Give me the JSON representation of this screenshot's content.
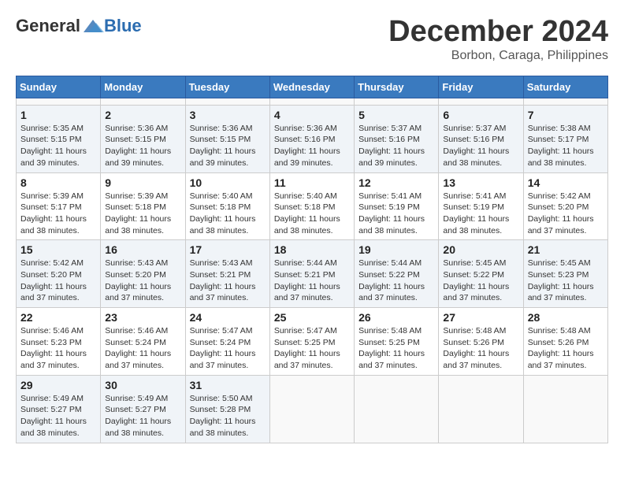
{
  "header": {
    "logo_general": "General",
    "logo_blue": "Blue",
    "month_title": "December 2024",
    "location": "Borbon, Caraga, Philippines"
  },
  "calendar": {
    "headers": [
      "Sunday",
      "Monday",
      "Tuesday",
      "Wednesday",
      "Thursday",
      "Friday",
      "Saturday"
    ],
    "weeks": [
      [
        null,
        null,
        null,
        null,
        null,
        null,
        null
      ],
      [
        {
          "day": "1",
          "sunrise": "5:35 AM",
          "sunset": "5:15 PM",
          "daylight": "11 hours and 39 minutes."
        },
        {
          "day": "2",
          "sunrise": "5:36 AM",
          "sunset": "5:15 PM",
          "daylight": "11 hours and 39 minutes."
        },
        {
          "day": "3",
          "sunrise": "5:36 AM",
          "sunset": "5:15 PM",
          "daylight": "11 hours and 39 minutes."
        },
        {
          "day": "4",
          "sunrise": "5:36 AM",
          "sunset": "5:16 PM",
          "daylight": "11 hours and 39 minutes."
        },
        {
          "day": "5",
          "sunrise": "5:37 AM",
          "sunset": "5:16 PM",
          "daylight": "11 hours and 39 minutes."
        },
        {
          "day": "6",
          "sunrise": "5:37 AM",
          "sunset": "5:16 PM",
          "daylight": "11 hours and 38 minutes."
        },
        {
          "day": "7",
          "sunrise": "5:38 AM",
          "sunset": "5:17 PM",
          "daylight": "11 hours and 38 minutes."
        }
      ],
      [
        {
          "day": "8",
          "sunrise": "5:39 AM",
          "sunset": "5:17 PM",
          "daylight": "11 hours and 38 minutes."
        },
        {
          "day": "9",
          "sunrise": "5:39 AM",
          "sunset": "5:18 PM",
          "daylight": "11 hours and 38 minutes."
        },
        {
          "day": "10",
          "sunrise": "5:40 AM",
          "sunset": "5:18 PM",
          "daylight": "11 hours and 38 minutes."
        },
        {
          "day": "11",
          "sunrise": "5:40 AM",
          "sunset": "5:18 PM",
          "daylight": "11 hours and 38 minutes."
        },
        {
          "day": "12",
          "sunrise": "5:41 AM",
          "sunset": "5:19 PM",
          "daylight": "11 hours and 38 minutes."
        },
        {
          "day": "13",
          "sunrise": "5:41 AM",
          "sunset": "5:19 PM",
          "daylight": "11 hours and 38 minutes."
        },
        {
          "day": "14",
          "sunrise": "5:42 AM",
          "sunset": "5:20 PM",
          "daylight": "11 hours and 37 minutes."
        }
      ],
      [
        {
          "day": "15",
          "sunrise": "5:42 AM",
          "sunset": "5:20 PM",
          "daylight": "11 hours and 37 minutes."
        },
        {
          "day": "16",
          "sunrise": "5:43 AM",
          "sunset": "5:20 PM",
          "daylight": "11 hours and 37 minutes."
        },
        {
          "day": "17",
          "sunrise": "5:43 AM",
          "sunset": "5:21 PM",
          "daylight": "11 hours and 37 minutes."
        },
        {
          "day": "18",
          "sunrise": "5:44 AM",
          "sunset": "5:21 PM",
          "daylight": "11 hours and 37 minutes."
        },
        {
          "day": "19",
          "sunrise": "5:44 AM",
          "sunset": "5:22 PM",
          "daylight": "11 hours and 37 minutes."
        },
        {
          "day": "20",
          "sunrise": "5:45 AM",
          "sunset": "5:22 PM",
          "daylight": "11 hours and 37 minutes."
        },
        {
          "day": "21",
          "sunrise": "5:45 AM",
          "sunset": "5:23 PM",
          "daylight": "11 hours and 37 minutes."
        }
      ],
      [
        {
          "day": "22",
          "sunrise": "5:46 AM",
          "sunset": "5:23 PM",
          "daylight": "11 hours and 37 minutes."
        },
        {
          "day": "23",
          "sunrise": "5:46 AM",
          "sunset": "5:24 PM",
          "daylight": "11 hours and 37 minutes."
        },
        {
          "day": "24",
          "sunrise": "5:47 AM",
          "sunset": "5:24 PM",
          "daylight": "11 hours and 37 minutes."
        },
        {
          "day": "25",
          "sunrise": "5:47 AM",
          "sunset": "5:25 PM",
          "daylight": "11 hours and 37 minutes."
        },
        {
          "day": "26",
          "sunrise": "5:48 AM",
          "sunset": "5:25 PM",
          "daylight": "11 hours and 37 minutes."
        },
        {
          "day": "27",
          "sunrise": "5:48 AM",
          "sunset": "5:26 PM",
          "daylight": "11 hours and 37 minutes."
        },
        {
          "day": "28",
          "sunrise": "5:48 AM",
          "sunset": "5:26 PM",
          "daylight": "11 hours and 37 minutes."
        }
      ],
      [
        {
          "day": "29",
          "sunrise": "5:49 AM",
          "sunset": "5:27 PM",
          "daylight": "11 hours and 38 minutes."
        },
        {
          "day": "30",
          "sunrise": "5:49 AM",
          "sunset": "5:27 PM",
          "daylight": "11 hours and 38 minutes."
        },
        {
          "day": "31",
          "sunrise": "5:50 AM",
          "sunset": "5:28 PM",
          "daylight": "11 hours and 38 minutes."
        },
        null,
        null,
        null,
        null
      ]
    ]
  }
}
